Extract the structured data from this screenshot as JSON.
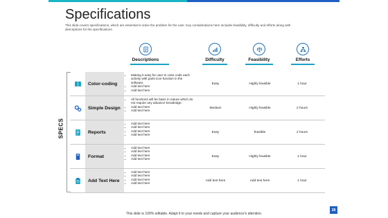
{
  "slide": {
    "title": "Specifications",
    "subtitle": "This slide covers specifications, which are essential to solve the problem for the user. Key considerations here includes feasibility, difficulty and efforts along with descriptions for the specifications.",
    "side_label": "SPECS",
    "footer": "This slide is 100% editable. Adapt it to your needs and capture your audience's attention.",
    "page_number": "28"
  },
  "columns": [
    {
      "label": "Descriptions",
      "icon": "document-icon"
    },
    {
      "label": "Difficulty",
      "icon": "bar-chart-icon"
    },
    {
      "label": "Feasibility",
      "icon": "balance-scale-icon"
    },
    {
      "label": "Efforts",
      "icon": "flow-chart-icon"
    }
  ],
  "rows": [
    {
      "name": "Color-coding",
      "icon": "book-icon",
      "descriptions": [
        "Making it easy for user to color code each activity with paint icon function in the software.",
        "Add text here",
        "Add text here"
      ],
      "difficulty": "Easy",
      "feasibility": "Highly feasible",
      "efforts": "1 hour"
    },
    {
      "name": "Simple Design",
      "icon": "gears-icon",
      "descriptions": [
        "All functions will be basic in nature which do not require any advance knowledge.",
        "Add text here",
        "Add text here"
      ],
      "difficulty": "Medium",
      "feasibility": "Highly feasible",
      "efforts": "2 hours"
    },
    {
      "name": "Reports",
      "icon": "report-icon",
      "descriptions": [
        "Add text here",
        "Add text here",
        "Add text here",
        "Add text here"
      ],
      "difficulty": "Easy",
      "feasibility": "feasible",
      "efforts": "2 hours"
    },
    {
      "name": "Format",
      "icon": "format-icon",
      "descriptions": [
        "Add text here",
        "Add text here",
        "Add text here",
        "Add text here"
      ],
      "difficulty": "Easy",
      "feasibility": "Highly feasible",
      "efforts": "1 hour"
    },
    {
      "name": "Add Text Here",
      "icon": "clipboard-icon",
      "descriptions": [
        "Add text here",
        "Add text here",
        "Add text here",
        "Add text here"
      ],
      "difficulty": "Add text here",
      "feasibility": "Add text here",
      "efforts": "1 hour"
    }
  ],
  "colors": {
    "accent_teal": "#17b6c4",
    "accent_blue": "#1f5fc4",
    "icon_blue": "#1f6fb5"
  }
}
